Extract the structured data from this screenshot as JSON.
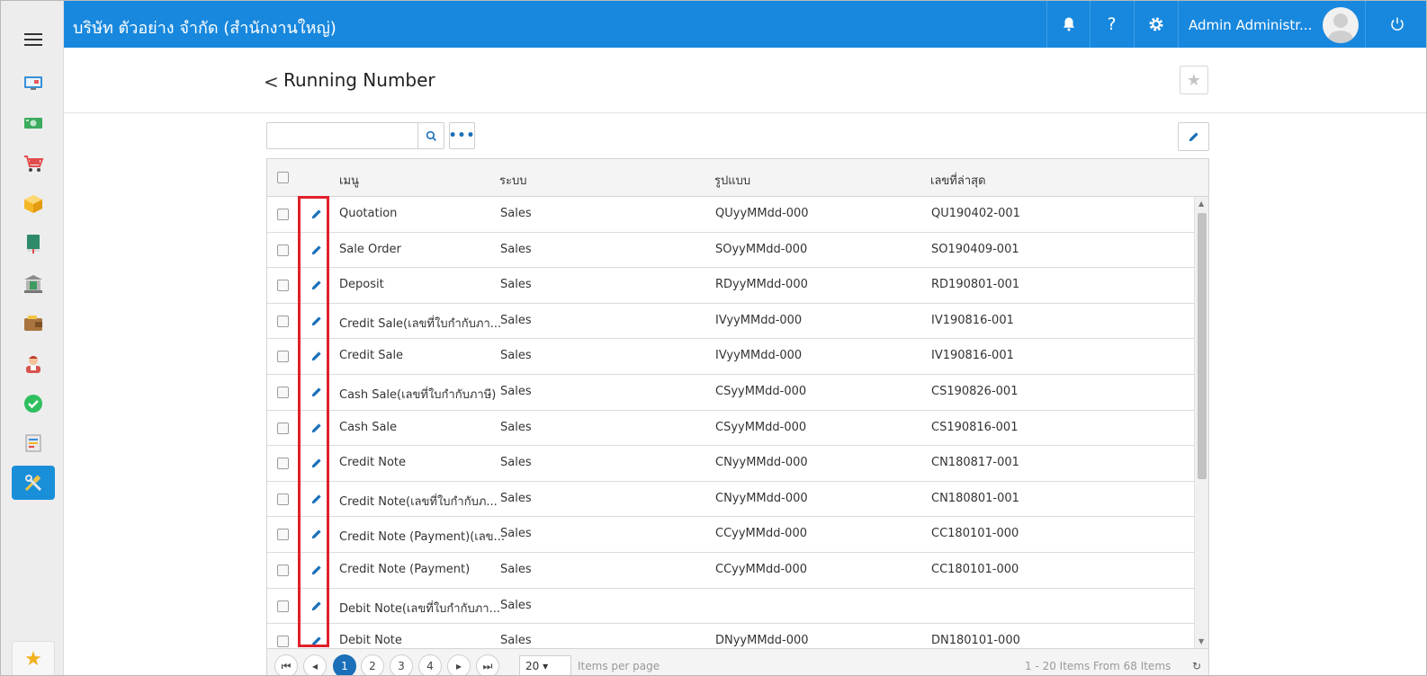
{
  "topbar": {
    "company": "บริษัท ตัวอย่าง จำกัด (สำนักงานใหญ่)",
    "user_name": "Admin Administr...",
    "notification_icon": "bell-icon",
    "help_icon": "?",
    "settings_icon": "gear-icon"
  },
  "page": {
    "title": "Running Number",
    "back_icon": "<"
  },
  "search": {
    "placeholder": "",
    "value": ""
  },
  "more_label": "•••",
  "grid": {
    "columns": [
      "เมนู",
      "ระบบ",
      "รูปแบบ",
      "เลขที่ล่าสุด"
    ],
    "rows": [
      {
        "menu": "Quotation",
        "system": "Sales",
        "format": "QUyyMMdd-000",
        "latest": "QU190402-001"
      },
      {
        "menu": "Sale Order",
        "system": "Sales",
        "format": "SOyyMMdd-000",
        "latest": "SO190409-001"
      },
      {
        "menu": "Deposit",
        "system": "Sales",
        "format": "RDyyMMdd-000",
        "latest": "RD190801-001"
      },
      {
        "menu": "Credit Sale(เลขที่ใบกำกับภา...",
        "system": "Sales",
        "format": "IVyyMMdd-000",
        "latest": "IV190816-001"
      },
      {
        "menu": "Credit Sale",
        "system": "Sales",
        "format": "IVyyMMdd-000",
        "latest": "IV190816-001"
      },
      {
        "menu": "Cash Sale(เลขที่ใบกำกับภาษี)",
        "system": "Sales",
        "format": "CSyyMMdd-000",
        "latest": "CS190826-001"
      },
      {
        "menu": "Cash Sale",
        "system": "Sales",
        "format": "CSyyMMdd-000",
        "latest": "CS190816-001"
      },
      {
        "menu": "Credit Note",
        "system": "Sales",
        "format": "CNyyMMdd-000",
        "latest": "CN180817-001"
      },
      {
        "menu": "Credit Note(เลขที่ใบกำกับภ...",
        "system": "Sales",
        "format": "CNyyMMdd-000",
        "latest": "CN180801-001"
      },
      {
        "menu": "Credit Note (Payment)(เลข...",
        "system": "Sales",
        "format": "CCyyMMdd-000",
        "latest": "CC180101-000"
      },
      {
        "menu": "Credit Note (Payment)",
        "system": "Sales",
        "format": "CCyyMMdd-000",
        "latest": "CC180101-000"
      },
      {
        "menu": "Debit Note(เลขที่ใบกำกับภา...",
        "system": "Sales",
        "format": "",
        "latest": ""
      },
      {
        "menu": "Debit Note",
        "system": "Sales",
        "format": "DNyyMMdd-000",
        "latest": "DN180101-000"
      }
    ]
  },
  "pager": {
    "pages": [
      "1",
      "2",
      "3",
      "4"
    ],
    "current": "1",
    "page_size": "20",
    "items_per_page": "Items per page",
    "summary": "1 - 20 Items From 68 Items"
  },
  "colors": {
    "topbar": "#1888de",
    "accent": "#1a6fb8",
    "highlight": "#e0202b"
  }
}
